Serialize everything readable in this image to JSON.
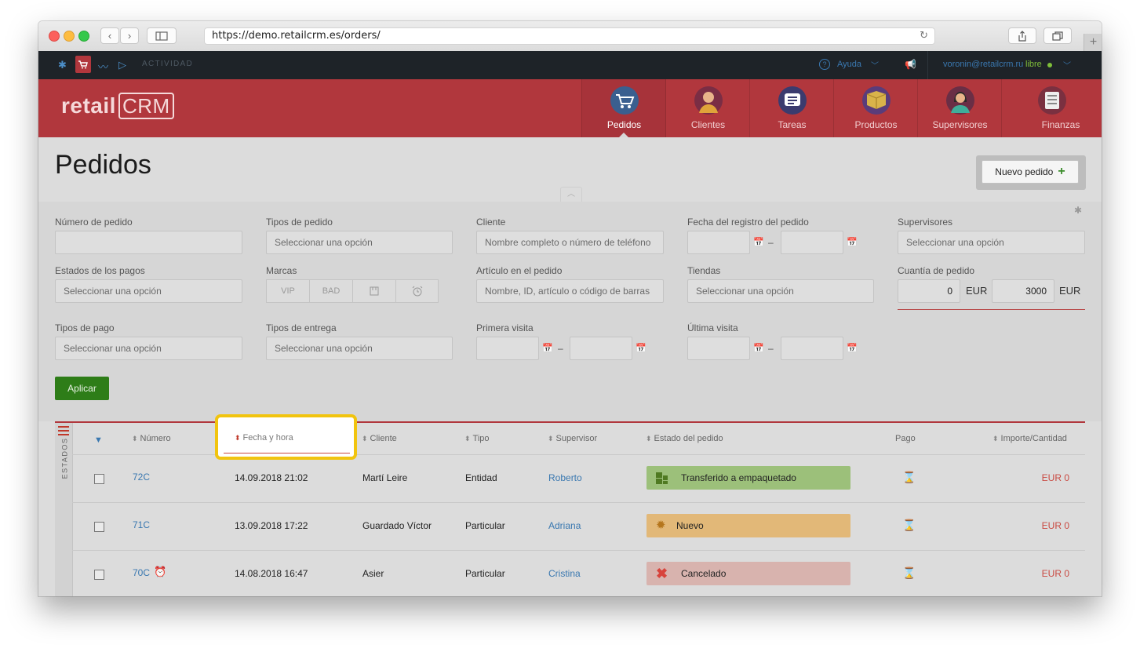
{
  "browser": {
    "url": "https://demo.retailcrm.es/orders/",
    "nav_back": "‹",
    "nav_forward": "›"
  },
  "topbar": {
    "activity_label": "ACTIVIDAD",
    "help_label": "Ayuda",
    "user_email": "voronin@retailcrm.ru",
    "user_status": "libre"
  },
  "header": {
    "logo": "retail",
    "logo_crm": "CRM",
    "nav": [
      {
        "label": "Pedidos",
        "icon": "cart-icon",
        "color": "#3a5f8f"
      },
      {
        "label": "Clientes",
        "icon": "client-avatar-icon",
        "color": "#7a2d44"
      },
      {
        "label": "Tareas",
        "icon": "tasks-icon",
        "color": "#3b3b6e"
      },
      {
        "label": "Productos",
        "icon": "box-icon",
        "color": "#5a3c7a"
      },
      {
        "label": "Supervisores",
        "icon": "supervisor-avatar-icon",
        "color": "#6a2e45"
      },
      {
        "label": "Finanzas",
        "icon": "finance-icon",
        "color": "#7a3040"
      }
    ]
  },
  "page": {
    "title": "Pedidos",
    "new_order_label": "Nuevo pedido",
    "new_order_plus": "+"
  },
  "filters": {
    "order_number_label": "Número de pedido",
    "order_types_label": "Tipos de pedido",
    "order_types_placeholder": "Seleccionar una opción",
    "client_label": "Cliente",
    "client_placeholder": "Nombre completo o número de teléfono",
    "reg_date_label": "Fecha del registro del pedido",
    "supervisors_label": "Supervisores",
    "supervisors_placeholder": "Seleccionar una opción",
    "payment_status_label": "Estados de los pagos",
    "payment_status_placeholder": "Seleccionar una opción",
    "brands_label": "Marcas",
    "brand_vip": "VIP",
    "brand_bad": "BAD",
    "item_label": "Artículo en el pedido",
    "item_placeholder": "Nombre, ID, artículo o código de barras",
    "stores_label": "Tiendas",
    "stores_placeholder": "Seleccionar una opción",
    "amount_label": "Cuantía de pedido",
    "amount_from": "0",
    "amount_to": "3000",
    "currency": "EUR",
    "payment_types_label": "Tipos de pago",
    "payment_types_placeholder": "Seleccionar una opción",
    "delivery_types_label": "Tipos de entrega",
    "delivery_types_placeholder": "Seleccionar una opción",
    "first_visit_label": "Primera visita",
    "last_visit_label": "Última visita",
    "dash": "–",
    "apply_label": "Aplicar"
  },
  "table": {
    "estados_label": "ESTADOS",
    "headers": {
      "number": "Número",
      "datetime": "Fecha y hora",
      "client": "Cliente",
      "type": "Tipo",
      "supervisor": "Supervisor",
      "status": "Estado del pedido",
      "payment": "Pago",
      "amount": "Importe/Cantidad"
    },
    "rows": [
      {
        "number": "72C",
        "datetime": "14.09.2018 21:02",
        "client": "Martí Leire",
        "type": "Entidad",
        "supervisor": "Roberto",
        "status": "Transferido a empaquetado",
        "status_color": "#9cc07a",
        "status_icon": "boxes-icon",
        "amount": "EUR 0",
        "alarm": false
      },
      {
        "number": "71C",
        "datetime": "13.09.2018 17:22",
        "client": "Guardado Víctor",
        "type": "Particular",
        "supervisor": "Adriana",
        "status": "Nuevo",
        "status_color": "#e2b878",
        "status_icon": "lightbulb-icon",
        "amount": "EUR 0",
        "alarm": false
      },
      {
        "number": "70C",
        "datetime": "14.08.2018 16:47",
        "client": "Asier",
        "type": "Particular",
        "supervisor": "Cristina",
        "status": "Cancelado",
        "status_color": "#d8b3ae",
        "status_icon": "cross-icon",
        "amount": "EUR 0",
        "alarm": true
      }
    ]
  },
  "highlight": {
    "label": "Fecha y hora"
  }
}
